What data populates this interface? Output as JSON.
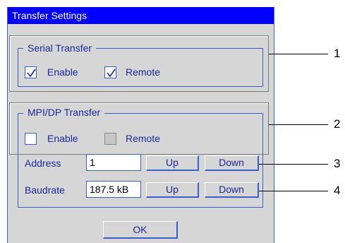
{
  "window": {
    "title": "Transfer Settings"
  },
  "serial": {
    "legend": "Serial Transfer",
    "enable": {
      "label": "Enable",
      "checked": true
    },
    "remote": {
      "label": "Remote",
      "checked": true
    }
  },
  "mpi": {
    "legend": "MPI/DP Transfer",
    "enable": {
      "label": "Enable",
      "checked": false
    },
    "remote": {
      "label": "Remote",
      "checked": false
    }
  },
  "address": {
    "label": "Address",
    "value": "1",
    "up_label": "Up",
    "down_label": "Down"
  },
  "baudrate": {
    "label": "Baudrate",
    "value": "187.5 kB",
    "up_label": "Up",
    "down_label": "Down"
  },
  "ok_label": "OK",
  "callouts": [
    "1",
    "2",
    "3",
    "4"
  ]
}
